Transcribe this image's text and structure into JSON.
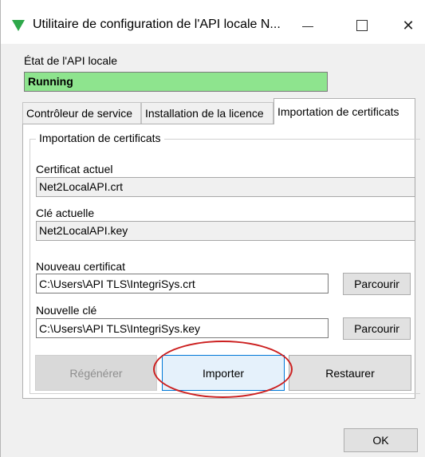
{
  "window": {
    "title": "Utilitaire de configuration de l'API locale N...",
    "minimize_glyph": "—",
    "maximize_glyph": "☐",
    "close_glyph": "✕"
  },
  "api_state": {
    "label": "État de l'API locale",
    "value": "Running",
    "color": "#8ee48e"
  },
  "tabs": [
    {
      "label": "Contrôleur de service",
      "active": false
    },
    {
      "label": "Installation de la licence",
      "active": false
    },
    {
      "label": "Importation de certificats",
      "active": true
    }
  ],
  "certificate_import": {
    "group_title": "Importation de certificats",
    "current_certificate_label": "Certificat actuel",
    "current_certificate_value": "Net2LocalAPI.crt",
    "current_key_label": "Clé actuelle",
    "current_key_value": "Net2LocalAPI.key",
    "new_certificate_label": "Nouveau certificat",
    "new_certificate_value": "C:\\Users\\API TLS\\IntegriSys.crt",
    "new_key_label": "Nouvelle clé",
    "new_key_value": "C:\\Users\\API TLS\\IntegriSys.key",
    "browse_label": "Parcourir",
    "regenerate_label": "Régénérer",
    "import_label": "Importer",
    "restore_label": "Restaurer"
  },
  "footer": {
    "ok_label": "OK"
  },
  "colors": {
    "highlight": "#cc1f1f",
    "focus": "#0078d7",
    "icon": "#2ea84a"
  }
}
